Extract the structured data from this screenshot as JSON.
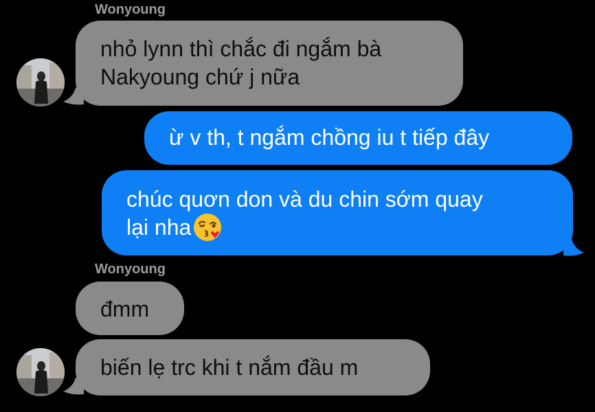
{
  "messages": [
    {
      "sender": "Wonyoung",
      "direction": "incoming",
      "lines": [
        "nhỏ lynn thì chắc đi ngắm bà",
        "Nakyoung chứ j nữa"
      ]
    },
    {
      "direction": "outgoing",
      "lines": [
        "ừ v th, t ngắm chồng iu t tiếp đây"
      ]
    },
    {
      "direction": "outgoing",
      "lines": [
        "chúc quơn don và du chin sớm quay",
        "lại nha"
      ],
      "emoji": "kissing-face-with-heart-icon"
    },
    {
      "sender": "Wonyoung",
      "direction": "incoming",
      "lines": [
        "đmm"
      ]
    },
    {
      "direction": "incoming",
      "lines": [
        "biến lẹ trc khi t nắm đầu m"
      ]
    }
  ],
  "colors": {
    "background": "#000000",
    "incoming_bubble": "#8a8a8d",
    "outgoing_bubble": "#0f7ff6",
    "sender_name": "#9b9b9f"
  }
}
